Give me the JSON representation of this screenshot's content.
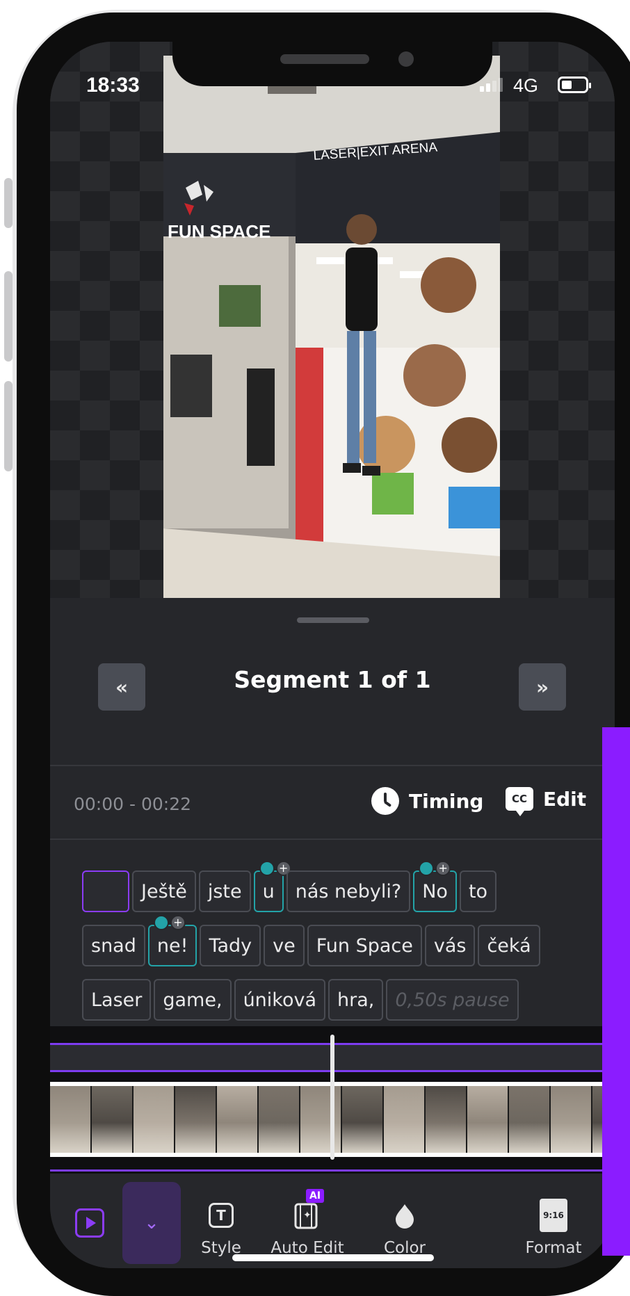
{
  "status_bar": {
    "time": "18:33",
    "network": "4G"
  },
  "video": {
    "sign_left": "FUN SPACE",
    "sign_right": "LASER|EXIT ARENA"
  },
  "segment": {
    "prev_label": "«",
    "next_label": "»",
    "title": "Segment 1 of 1"
  },
  "subtitle_bar": {
    "time_range": "00:00 - 00:22",
    "timing_label": "Timing",
    "edit_label": "Edit",
    "cc_label": "CC"
  },
  "words": {
    "row1": [
      "",
      "Ještě",
      "jste",
      "u",
      "nás nebyli?",
      "No",
      "to"
    ],
    "row2": [
      "snad",
      "ne!",
      "Tady",
      "ve",
      "Fun Space",
      "vás",
      "čeká"
    ],
    "row3": [
      "Laser",
      "game,",
      "úniková",
      "hra,",
      "0,50s pause"
    ]
  },
  "toolbar": {
    "style_label": "Style",
    "auto_edit_label": "Auto Edit",
    "ai_badge": "AI",
    "color_label": "Color",
    "format_label": "Format",
    "format_icon_text": "9:16"
  },
  "colors": {
    "accent": "#8b1cff",
    "teal": "#23a3a8",
    "panel_bg": "#26272b"
  }
}
